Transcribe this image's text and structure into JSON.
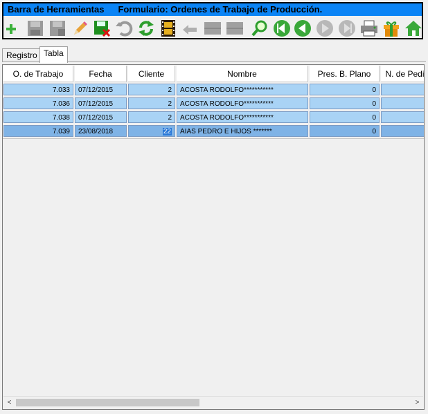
{
  "title_bar": {
    "left_text": "Barra de Herramientas",
    "right_text": "Formulario: Ordenes de Trabajo de Producción."
  },
  "toolbar": {
    "buttons": [
      {
        "name": "new-record-icon",
        "enabled": true
      },
      {
        "name": "save-icon",
        "enabled": false
      },
      {
        "name": "save-as-icon",
        "enabled": false
      },
      {
        "name": "edit-pencil-icon",
        "enabled": true
      },
      {
        "name": "delete-record-icon",
        "enabled": true
      },
      {
        "name": "undo-icon",
        "enabled": false
      },
      {
        "name": "refresh-icon",
        "enabled": true
      },
      {
        "name": "film-icon",
        "enabled": true
      },
      {
        "name": "back-arrow-icon",
        "enabled": false
      },
      {
        "name": "blank-icon-1",
        "enabled": false
      },
      {
        "name": "blank-icon-2",
        "enabled": false
      },
      {
        "name": "search-icon",
        "enabled": true
      },
      {
        "name": "first-record-icon",
        "enabled": true
      },
      {
        "name": "previous-record-icon",
        "enabled": true
      },
      {
        "name": "next-record-icon",
        "enabled": false
      },
      {
        "name": "last-record-icon",
        "enabled": false
      },
      {
        "name": "print-icon",
        "enabled": true
      },
      {
        "name": "gift-icon",
        "enabled": true
      },
      {
        "name": "home-icon",
        "enabled": true
      }
    ]
  },
  "tabs": [
    {
      "label": "Registro",
      "active": false
    },
    {
      "label": "Tabla",
      "active": true
    }
  ],
  "grid": {
    "headers": [
      "O. de Trabajo",
      "Fecha",
      "Cliente",
      "Nombre",
      "Pres. B. Plano",
      "N. de Pedi"
    ],
    "rows": [
      {
        "orden": "7.033",
        "fecha": "07/12/2015",
        "cliente": "2",
        "nombre": "ACOSTA RODOLFO***********",
        "pres": "0",
        "selected": false
      },
      {
        "orden": "7.036",
        "fecha": "07/12/2015",
        "cliente": "2",
        "nombre": "ACOSTA RODOLFO***********",
        "pres": "0",
        "selected": false
      },
      {
        "orden": "7.038",
        "fecha": "07/12/2015",
        "cliente": "2",
        "nombre": "ACOSTA RODOLFO***********",
        "pres": "0",
        "selected": false
      },
      {
        "orden": "7.039",
        "fecha": "23/08/2018",
        "cliente": "22",
        "nombre": "AIAS PEDRO E HIJOS *******",
        "pres": "0",
        "selected": true
      }
    ]
  },
  "scrollbar": {
    "left_arrow": "<",
    "right_arrow": ">"
  }
}
